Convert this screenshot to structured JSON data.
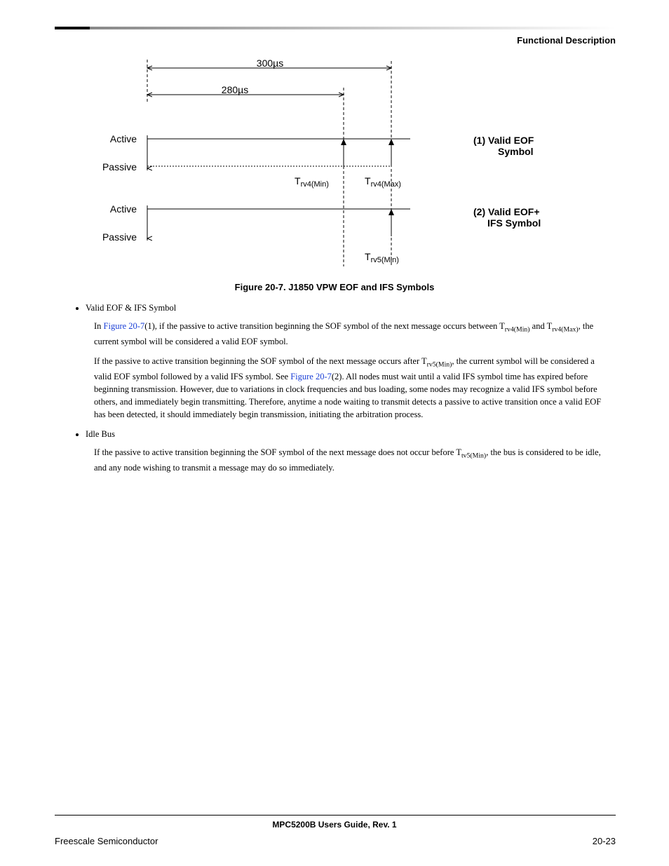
{
  "header": {
    "section_title": "Functional Description"
  },
  "figure": {
    "dim_300": "300",
    "dim_280": "280",
    "us": "µs",
    "active": "Active",
    "passive": "Passive",
    "trv4min": "rv4(Min)",
    "trv4max": "rv4(Max)",
    "trv5min": "rv5(Min)",
    "side1a": "(1) Valid EOF",
    "side1b": "Symbol",
    "side2a": "(2) Valid EOF+",
    "side2b": "IFS Symbol",
    "caption": "Figure 20-7. J1850 VPW EOF and IFS Symbols"
  },
  "body": {
    "bullet1": "Valid EOF & IFS Symbol",
    "p1a": "In ",
    "p1_link": "Figure 20-7",
    "p1b": "(1), if the passive to active transition beginning the SOF symbol of the next message occurs between T",
    "p1_sub1": "rv4(Min)",
    "p1c": " and T",
    "p1_sub2": "rv4(Max)",
    "p1d": ", the current symbol will be considered a valid EOF symbol.",
    "p2a": "If the passive to active transition beginning the SOF symbol of the next message occurs after T",
    "p2_sub1": "rv5(Min)",
    "p2b": ", the current symbol will be considered a valid EOF symbol followed by a valid IFS symbol. See ",
    "p2_link": "Figure 20-7",
    "p2c": "(2). All nodes must wait until a valid IFS symbol time has expired before beginning transmission. However, due to variations in clock frequencies and bus loading, some nodes may recognize a valid IFS symbol before others, and immediately begin transmitting. Therefore, anytime a node waiting to transmit detects a passive to active transition once a valid EOF has been detected, it should immediately begin transmission, initiating the arbitration process.",
    "bullet2": "Idle Bus",
    "p3a": "If the passive to active transition beginning the SOF symbol of the next message does not occur before T",
    "p3_sub1": "tv5(Min)",
    "p3b": ", the bus is considered to be idle, and any node wishing to transmit a message may do so immediately."
  },
  "footer": {
    "center": "MPC5200B Users Guide, Rev. 1",
    "left": "Freescale Semiconductor",
    "right": "20-23"
  }
}
